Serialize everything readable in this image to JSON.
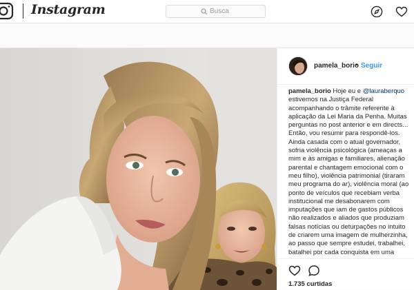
{
  "app": {
    "name": "Instagram"
  },
  "search": {
    "placeholder": "Busca"
  },
  "post": {
    "username": "pamela_borio",
    "separator": "•",
    "follow_label": "Seguir",
    "caption": {
      "username": "pamela_borio",
      "text_before_mention": "Hoje eu e",
      "mention": "@lauraberquo",
      "text_after_mention": "estivemos na Justiça Federal acompanhando o trâmite referente à aplicação da Lei Maria da Penha. Muitas perguntas no post anterior e em directs... Então, vou resumir para respondê-los. Ainda casada com o atual governador, sofria violência psicológica (ameaças a mim e às amigas e familiares, alienação parental e chantagem emocional com o meu filho), violência patrimonial (tiraram meu programa do ar), violência moral (ao ponto de veículos que recebiam verba institucional me desabonarem com imputações que iam de gastos públicos não realizados e aliados que produziam falsas notícias ou deturpações no intuito de criarem uma imagem de mulherzinha, ao passo que sempre estudei, trabalhei, batalhei por cada conquista em uma"
    },
    "likes": "1.735 curtidas"
  },
  "icons": {
    "logo": "instagram-glyph-icon",
    "search": "search-icon",
    "explore": "compass-icon",
    "activity": "heart-icon",
    "like": "heart-outline-icon",
    "comment": "comment-icon"
  },
  "colors": {
    "link": "#3897f0",
    "mention": "#003569",
    "text": "#262626"
  }
}
